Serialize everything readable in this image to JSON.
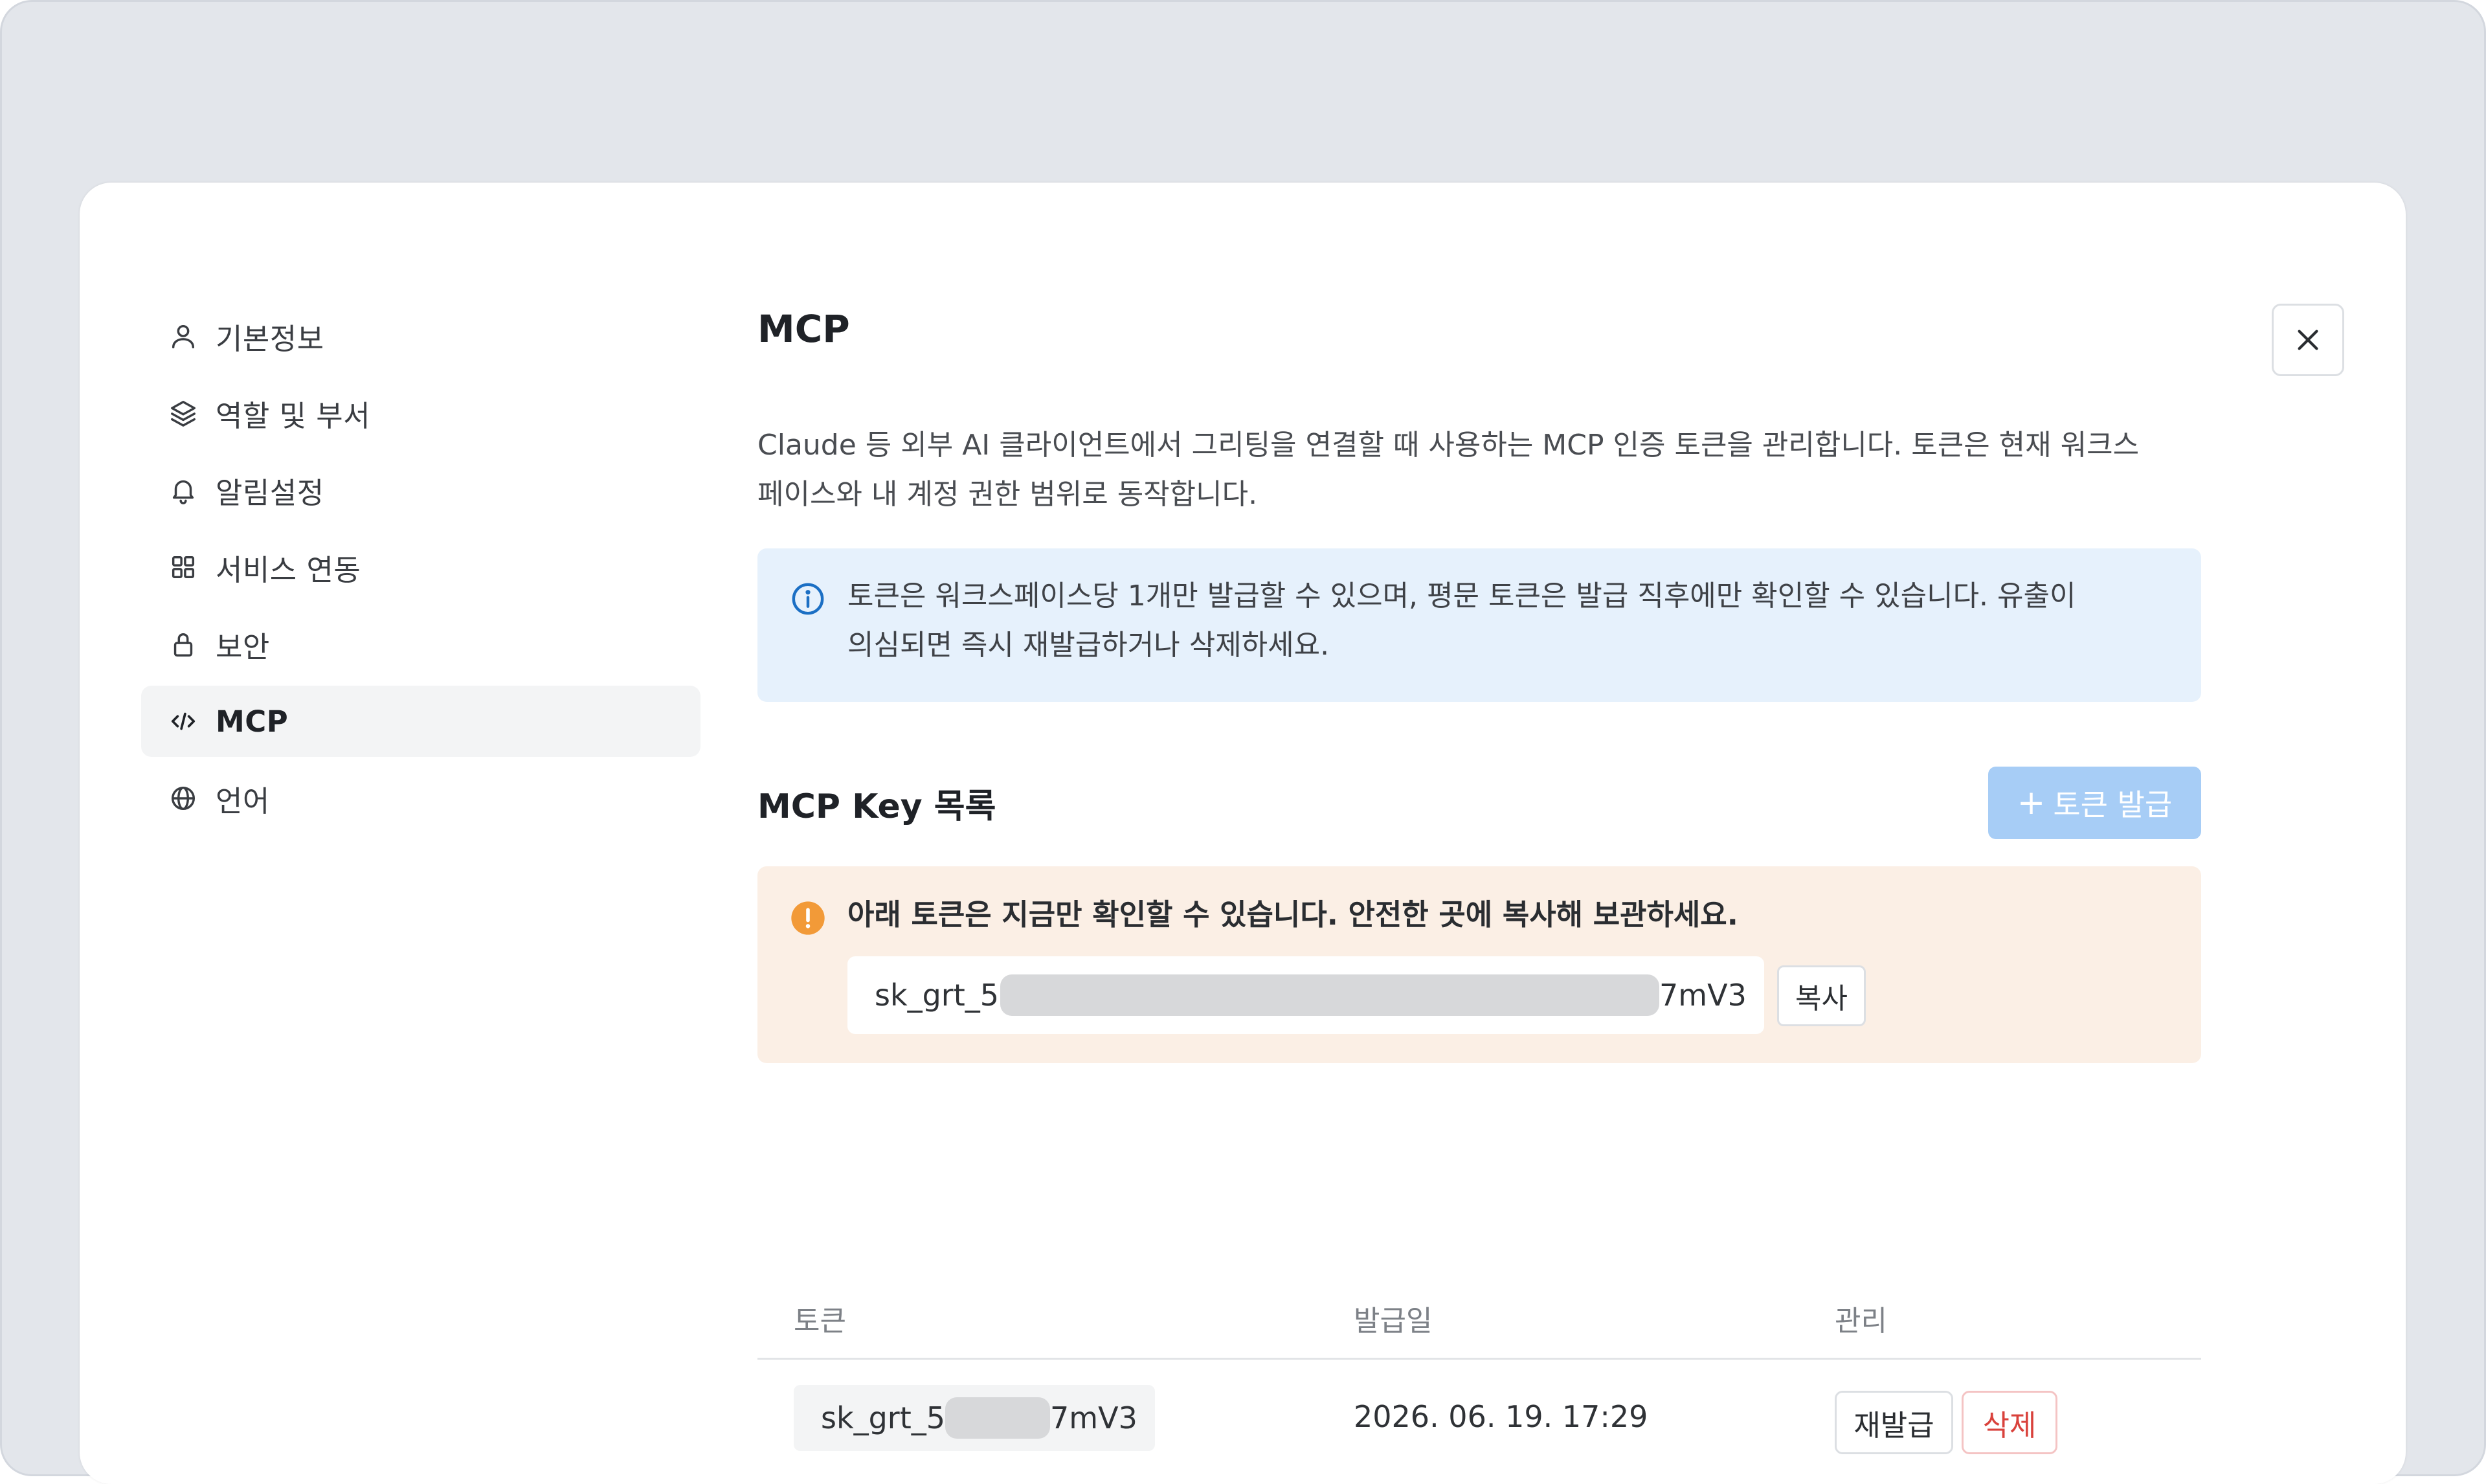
{
  "sidebar": {
    "items": [
      {
        "label": "기본정보",
        "icon": "user-icon",
        "active": false
      },
      {
        "label": "역할 및 부서",
        "icon": "layers-icon",
        "active": false
      },
      {
        "label": "알림설정",
        "icon": "bell-icon",
        "active": false
      },
      {
        "label": "서비스 연동",
        "icon": "grid-icon",
        "active": false
      },
      {
        "label": "보안",
        "icon": "lock-icon",
        "active": false
      },
      {
        "label": "MCP",
        "icon": "code-icon",
        "active": true
      },
      {
        "label": "언어",
        "icon": "globe-icon",
        "active": false
      }
    ]
  },
  "main": {
    "title": "MCP",
    "description_line1": "Claude 등 외부 AI 클라이언트에서 그리팅을 연결할 때 사용하는 MCP 인증 토큰을 관리합니다. 토큰은 현재 워크스",
    "description_line2": "페이스와 내 계정 권한 범위로 동작합니다.",
    "info_line1": "토큰은 워크스페이스당 1개만 발급할 수 있으며, 평문 토큰은 발급 직후에만 확인할 수 있습니다. 유출이",
    "info_line2": "의심되면 즉시 재발급하거나 삭제하세요.",
    "section_title": "MCP Key 목록",
    "issue_button": "토큰 발급",
    "issue_button_plus": "+",
    "warning_text": "아래 토큰은 지금만 확인할 수 있습니다. 안전한 곳에 복사해 보관하세요.",
    "token_prefix": "sk_grt_5",
    "token_suffix": "7mV3",
    "copy_button": "복사",
    "table": {
      "columns": [
        "토큰",
        "발급일",
        "관리"
      ],
      "rows": [
        {
          "token_prefix": "sk_grt_5",
          "token_suffix": "7mV3",
          "issued_at": "2026. 06. 19. 17:29",
          "reissue": "재발급",
          "delete": "삭제"
        }
      ]
    }
  },
  "colors": {
    "accent_disabled": "#a7cdf6",
    "info_bg": "#e6f1fc",
    "info_icon": "#1b6fc4",
    "warn_bg": "#fbefe5",
    "warn_icon": "#f29a38",
    "danger": "#d9423c"
  }
}
